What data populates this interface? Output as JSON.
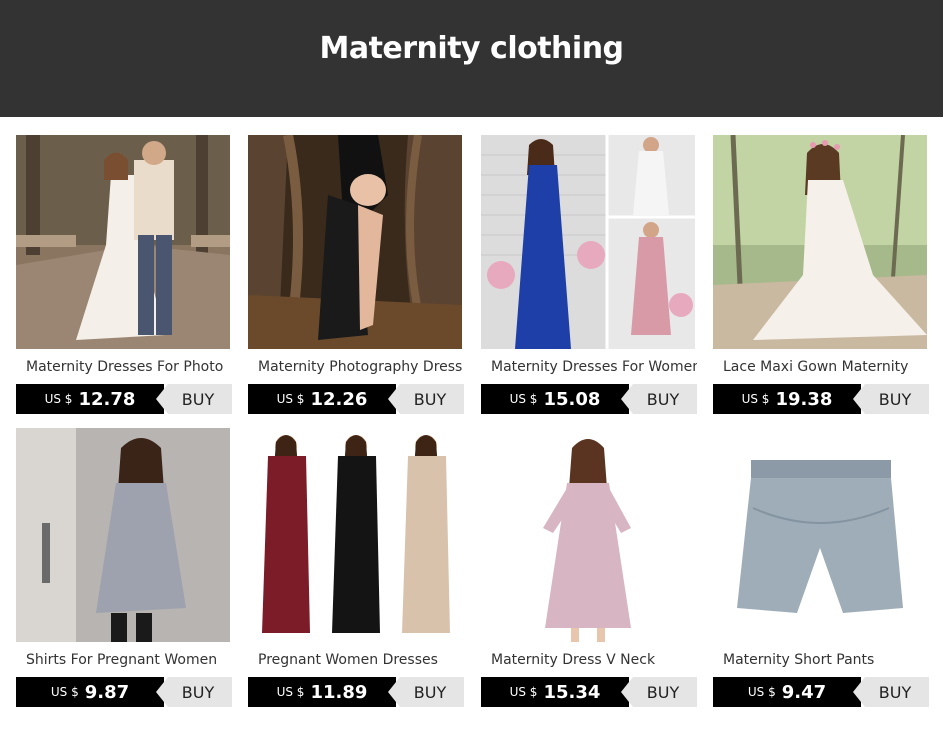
{
  "header": {
    "title": "Maternity clothing"
  },
  "currency_label": "US $",
  "buy_label": "BUY",
  "products": [
    {
      "title": "Maternity Dresses For Photo",
      "price": "12.78",
      "image": "couple-white-gown-photo"
    },
    {
      "title": "Maternity Photography Dress",
      "price": "12.26",
      "image": "black-lace-dress-forest"
    },
    {
      "title": "Maternity Dresses For Women",
      "price": "15.08",
      "image": "blue-and-pink-maxi-dresses"
    },
    {
      "title": "Lace Maxi Gown Maternity",
      "price": "19.38",
      "image": "white-lace-gown-forest"
    },
    {
      "title": "Shirts For Pregnant Women",
      "price": "9.87",
      "image": "grey-tunic-shirt"
    },
    {
      "title": "Pregnant Women Dresses",
      "price": "11.89",
      "image": "three-maxi-dresses"
    },
    {
      "title": "Maternity Dress V Neck",
      "price": "15.34",
      "image": "pink-pleated-dress"
    },
    {
      "title": "Maternity Short Pants",
      "price": "9.47",
      "image": "grey-shorts"
    }
  ],
  "colors": {
    "header_bg": "#333333",
    "price_bg": "#000000",
    "buy_bg": "#e5e5e5"
  }
}
